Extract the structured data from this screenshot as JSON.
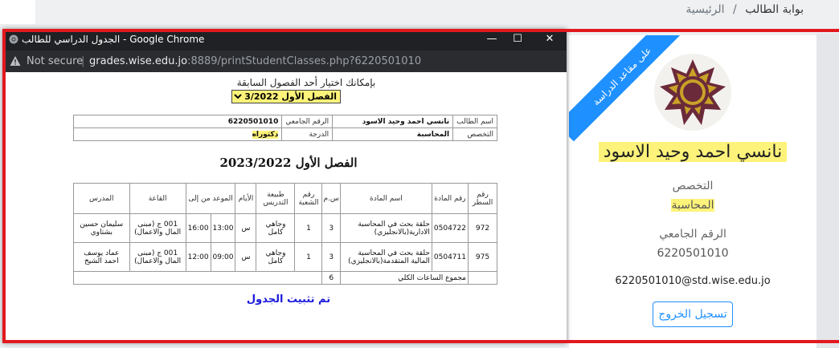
{
  "breadcrumb": {
    "current": "بوابة الطالب",
    "separator": "/",
    "home": "الرئيسية"
  },
  "card": {
    "ribbon": "على مقاعد الدراسة",
    "student_name": "نانسي احمد وحيد الاسود",
    "specialization_label": "التخصص",
    "specialization_value": "المحاسبة",
    "id_label": "الرقم الجامعي",
    "id_value": "6220501010",
    "email": "6220501010@std.wise.edu.jo",
    "logout_label": "تسجيل الخروج"
  },
  "popup": {
    "window_title": "الجدول الدراسي للطالب - Google Chrome",
    "url_not_secure": "Not secure",
    "url_host": "grades.wise.edu.jo",
    "url_rest": ":8889/printStudentClasses.php?6220501010",
    "choose_text": "بإمكانك اختيار أحد الفصول السابقة",
    "semester_option": "الفصل الأول 2023/2022",
    "info": {
      "name_label": "اسم الطالب",
      "name_value": "نانسي احمد وحيد الاسود",
      "id_label": "الرقم الجامعي",
      "id_value": "6220501010",
      "major_label": "التخصص",
      "major_value": "المحاسبة",
      "degree_label": "الدرجة",
      "degree_value": "دكتوراه"
    },
    "semester_heading": "الفصل الأول   2023/2022",
    "table": {
      "headers": {
        "row_no": "رقم السطر",
        "course_no": "رقم المادة",
        "course_name": "اسم المادة",
        "credits": "س.م",
        "section": "رقم الشعبة",
        "teaching_type": "طبيعة التدريس",
        "days": "الأيام",
        "time": "الموعد من إلى",
        "room": "القاعة",
        "instructor": "المدرس"
      },
      "rows": [
        {
          "row_no": "972",
          "course_no": "0504722",
          "course_name": "حلقة بحث في المحاسبة الادارية(بالانجليزي)",
          "credits": "3",
          "section": "1",
          "teaching_type": "وجاهي كامل",
          "days": "س",
          "time_from": "13:00",
          "time_to": "16:00",
          "room": "001 ج (مبنى المال والاعمال)",
          "instructor": "سليمان حسين بشتاوي"
        },
        {
          "row_no": "975",
          "course_no": "0504711",
          "course_name": "حلقة بحث في المحاسبة المالية المتقدمة(بالانجليزي)",
          "credits": "3",
          "section": "1",
          "teaching_type": "وجاهي كامل",
          "days": "س",
          "time_from": "09:00",
          "time_to": "12:00",
          "room": "001 ج (مبنى المال والاعمال)",
          "instructor": "عماد يوسف احمد الشيخ"
        }
      ],
      "total_label": "مجموع الساعات الكلي",
      "total_value": "6"
    },
    "fixed_message": "تم تثبيت الجدول"
  }
}
